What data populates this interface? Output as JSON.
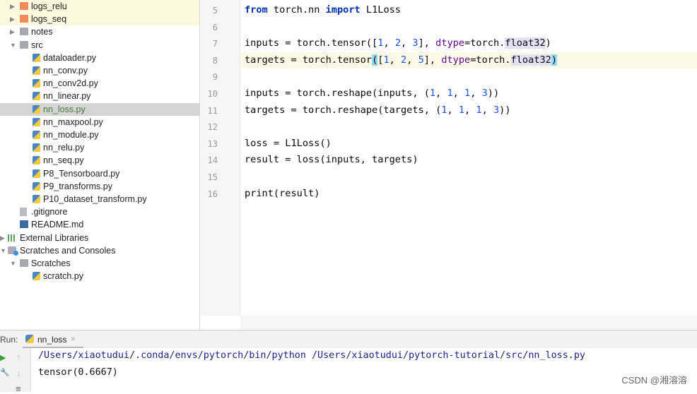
{
  "project_tree": [
    {
      "label": "logs_relu",
      "icon": "folder-orange",
      "arrow": "right",
      "level": 1,
      "state": "highlight"
    },
    {
      "label": "logs_seq",
      "icon": "folder-orange",
      "arrow": "right",
      "level": 1,
      "state": "highlight"
    },
    {
      "label": "notes",
      "icon": "folder-gray",
      "arrow": "right",
      "level": 1
    },
    {
      "label": "src",
      "icon": "folder-gray",
      "arrow": "down",
      "level": 1
    },
    {
      "label": "dataloader.py",
      "icon": "py",
      "level": 2
    },
    {
      "label": "nn_conv.py",
      "icon": "py",
      "level": 2
    },
    {
      "label": "nn_conv2d.py",
      "icon": "py",
      "level": 2
    },
    {
      "label": "nn_linear.py",
      "icon": "py",
      "level": 2
    },
    {
      "label": "nn_loss.py",
      "icon": "py",
      "level": 2,
      "state": "selected"
    },
    {
      "label": "nn_maxpool.py",
      "icon": "py",
      "level": 2
    },
    {
      "label": "nn_module.py",
      "icon": "py",
      "level": 2
    },
    {
      "label": "nn_relu.py",
      "icon": "py",
      "level": 2
    },
    {
      "label": "nn_seq.py",
      "icon": "py",
      "level": 2
    },
    {
      "label": "P8_Tensorboard.py",
      "icon": "py",
      "level": 2
    },
    {
      "label": "P9_transforms.py",
      "icon": "py",
      "level": 2
    },
    {
      "label": "P10_dataset_transform.py",
      "icon": "py",
      "level": 2
    },
    {
      "label": ".gitignore",
      "icon": "file",
      "level": 1
    },
    {
      "label": "README.md",
      "icon": "md",
      "level": 1
    },
    {
      "label": "External Libraries",
      "icon": "lib",
      "arrow": "right",
      "level": 0
    },
    {
      "label": "Scratches and Consoles",
      "icon": "scr",
      "arrow": "down",
      "level": 0
    },
    {
      "label": "Scratches",
      "icon": "folder-gray",
      "arrow": "down",
      "level": 1
    },
    {
      "label": "scratch.py",
      "icon": "py",
      "level": 2
    }
  ],
  "editor": {
    "current_line": 8,
    "lines": [
      {
        "n": "5",
        "tokens": [
          {
            "t": "from",
            "c": "kw"
          },
          {
            "t": " torch.nn "
          },
          {
            "t": "import",
            "c": "kw"
          },
          {
            "t": " L1Loss"
          }
        ]
      },
      {
        "n": "6",
        "tokens": []
      },
      {
        "n": "7",
        "tokens": [
          {
            "t": "inputs = torch.tensor(["
          },
          {
            "t": "1",
            "c": "num"
          },
          {
            "t": ", "
          },
          {
            "t": "2",
            "c": "num"
          },
          {
            "t": ", "
          },
          {
            "t": "3",
            "c": "num"
          },
          {
            "t": "], "
          },
          {
            "t": "dtype",
            "c": "kwarg"
          },
          {
            "t": "=torch."
          },
          {
            "t": "float32",
            "c": "hlbox"
          },
          {
            "t": ")"
          }
        ]
      },
      {
        "n": "8",
        "tokens": [
          {
            "t": "targets = torch.tensor"
          },
          {
            "t": "(",
            "c": "brk"
          },
          {
            "t": "["
          },
          {
            "t": "1",
            "c": "num"
          },
          {
            "t": ", "
          },
          {
            "t": "2",
            "c": "num"
          },
          {
            "t": ", "
          },
          {
            "t": "5",
            "c": "num"
          },
          {
            "t": "], "
          },
          {
            "t": "dtype",
            "c": "kwarg"
          },
          {
            "t": "=torch."
          },
          {
            "t": "float32",
            "c": "hlbox"
          },
          {
            "t": ")",
            "c": "brk"
          }
        ]
      },
      {
        "n": "9",
        "tokens": []
      },
      {
        "n": "10",
        "tokens": [
          {
            "t": "inputs = torch.reshape(inputs, ("
          },
          {
            "t": "1",
            "c": "num"
          },
          {
            "t": ", "
          },
          {
            "t": "1",
            "c": "num"
          },
          {
            "t": ", "
          },
          {
            "t": "1",
            "c": "num"
          },
          {
            "t": ", "
          },
          {
            "t": "3",
            "c": "num"
          },
          {
            "t": "))"
          }
        ]
      },
      {
        "n": "11",
        "tokens": [
          {
            "t": "targets = torch.reshape(targets, ("
          },
          {
            "t": "1",
            "c": "num"
          },
          {
            "t": ", "
          },
          {
            "t": "1",
            "c": "num"
          },
          {
            "t": ", "
          },
          {
            "t": "1",
            "c": "num"
          },
          {
            "t": ", "
          },
          {
            "t": "3",
            "c": "num"
          },
          {
            "t": "))"
          }
        ]
      },
      {
        "n": "12",
        "tokens": []
      },
      {
        "n": "13",
        "tokens": [
          {
            "t": "loss = L1Loss()"
          }
        ]
      },
      {
        "n": "14",
        "tokens": [
          {
            "t": "result = loss(inputs, targets)"
          }
        ]
      },
      {
        "n": "15",
        "tokens": []
      },
      {
        "n": "16",
        "tokens": [
          {
            "t": "print(result)"
          }
        ]
      }
    ]
  },
  "run": {
    "label": "Run:",
    "tab": "nn_loss",
    "output": [
      "/Users/xiaotudui/.conda/envs/pytorch/bin/python /Users/xiaotudui/pytorch-tutorial/src/nn_loss.py",
      "tensor(0.6667)"
    ]
  },
  "watermark": "CSDN @湘溶溶"
}
